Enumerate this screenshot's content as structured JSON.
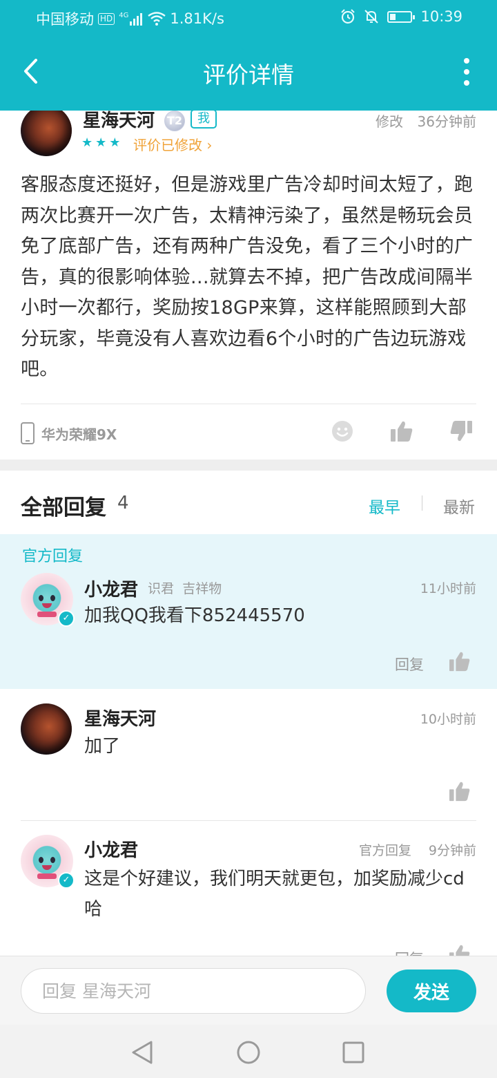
{
  "status_bar": {
    "carrier": "中国移动",
    "hd": "HD",
    "net": "4G",
    "speed": "1.81K/s",
    "battery_level": 0.3,
    "time": "10:39"
  },
  "header": {
    "title": "评价详情",
    "back_icon": "chevron-left-icon",
    "more_icon": "more-vertical-icon"
  },
  "review": {
    "author": "星海天河",
    "level": "T2",
    "me_badge": "我",
    "edit_label": "修改",
    "time": "36分钟前",
    "stars": "★★★",
    "rating": 3,
    "edited_label": "评价已修改",
    "body": "客服态度还挺好，但是游戏里广告冷却时间太短了，跑两次比赛开一次广告，太精神污染了，虽然是畅玩会员免了底部广告，还有两种广告没免，看了三个小时的广告，真的很影响体验…就算去不掉，把广告改成间隔半小时一次都行，奖励按18GP来算，这样能照顾到大部分玩家，毕竟没有人喜欢边看6个小时的广告边玩游戏吧。",
    "device": "华为荣耀9X"
  },
  "replies": {
    "title": "全部回复",
    "count": "4",
    "sort_earliest": "最早",
    "sort_latest": "最新",
    "official_label": "官方回复",
    "items": [
      {
        "author": "小龙君",
        "tags": "识君  吉祥物",
        "time": "11小时前",
        "text": "加我QQ我看下852445570",
        "reply_label": "回复"
      },
      {
        "author": "星海天河",
        "time": "10小时前",
        "text": "加了"
      },
      {
        "author": "小龙君",
        "tag": "官方回复",
        "time": "9分钟前",
        "text": "这是个好建议，我们明天就更包，加奖励减少cd哈",
        "reply_label": "回复"
      }
    ]
  },
  "input": {
    "placeholder": "回复 星海天河",
    "send_label": "发送"
  },
  "colors": {
    "accent": "#14b9c8",
    "orange": "#f0a339",
    "official_bg": "#e6f6fa"
  }
}
